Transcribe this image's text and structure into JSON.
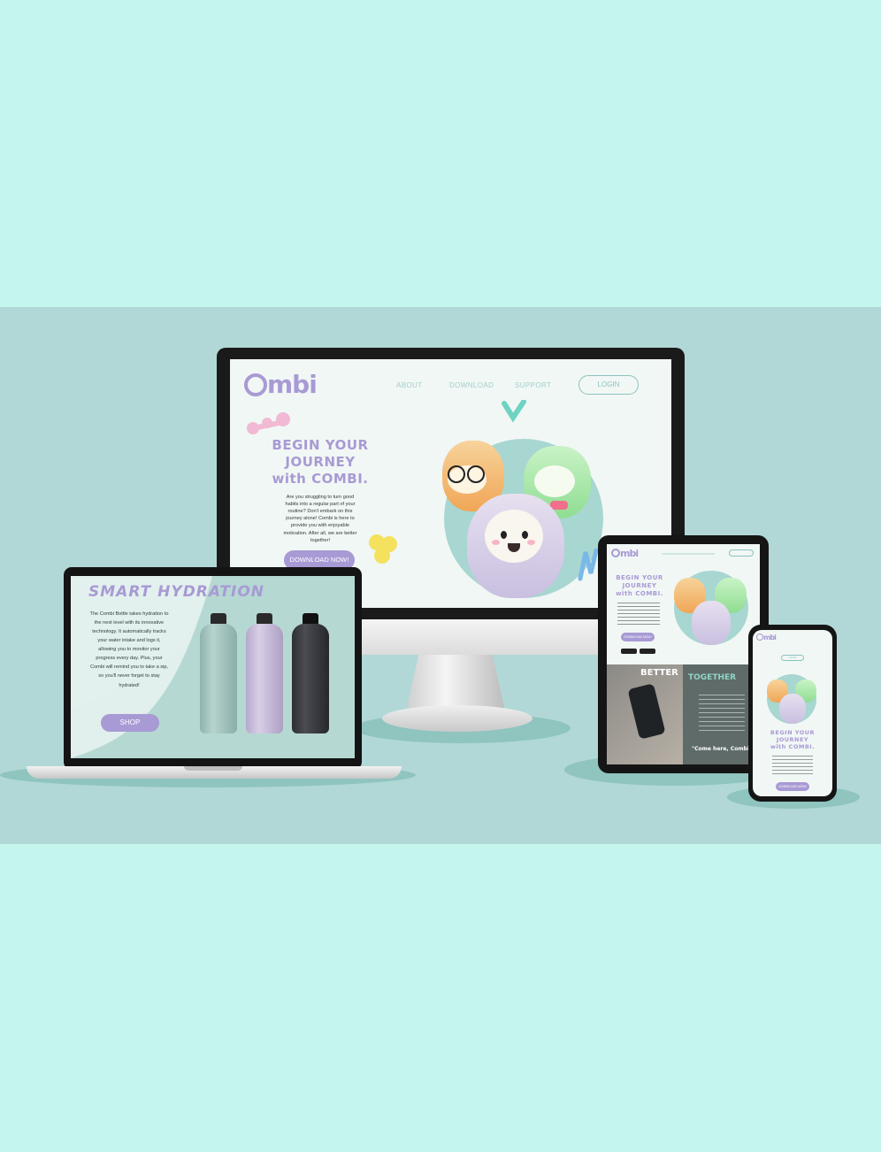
{
  "brand": {
    "name": "Combi",
    "accent": "#a89ad4",
    "teal": "#8cc3bd",
    "background": "#c4f6ee",
    "stage": "#b1d8d6"
  },
  "desktop": {
    "nav": [
      "ABOUT",
      "DOWNLOAD",
      "SUPPORT"
    ],
    "login": "LOGIN",
    "hero": {
      "title_line1": "BEGIN YOUR",
      "title_line2": "JOURNEY",
      "title_line3": "with COMBI.",
      "body": "Are you struggling to turn good habits into a regular part of your routine? Don't embark on this journey alone! Combi is here to provide you with enjoyable motivation. After all, we are better together!",
      "cta": "DOWNLOAD NOW!"
    }
  },
  "laptop": {
    "title": "SMART HYDRATION",
    "body": "The Combi Bottle takes hydration to the next level with its innovative technology. It automatically tracks your water intake and logs it, allowing you to monitor your progress every day. Plus, your Combi will remind you to take a sip, so you'll never forget to stay hydrated!",
    "cta": "SHOP",
    "bottle_colors": [
      "#9fbfba",
      "#c8bbd9",
      "#3a3c42"
    ]
  },
  "tablet": {
    "title_line1": "BEGIN YOUR",
    "title_line2": "JOURNEY",
    "title_line3": "with COMBI.",
    "cta": "DOWNLOAD NOW!",
    "section_title_left": "BETTER",
    "section_title_right": "TOGETHER",
    "quote": "\"Come here, Combi!\""
  },
  "phone": {
    "login": "LOGIN",
    "title_line1": "BEGIN YOUR",
    "title_line2": "JOURNEY",
    "title_line3": "with COMBI.",
    "cta": "DOWNLOAD NOW!"
  }
}
